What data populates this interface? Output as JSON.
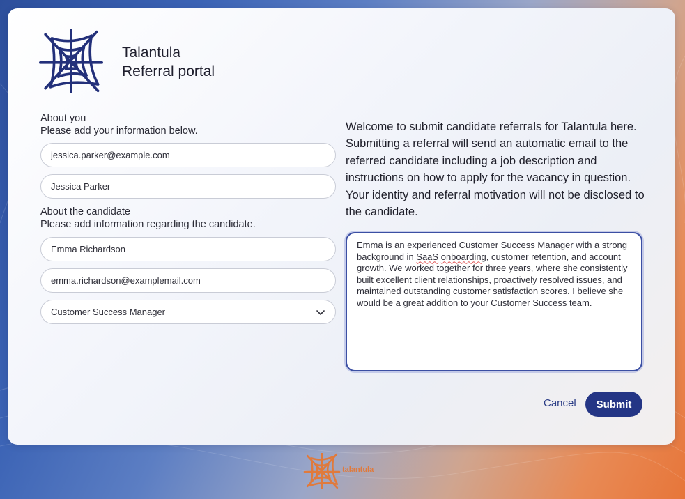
{
  "brand": {
    "line1": "Talantula",
    "line2": "Referral portal",
    "logo_icon": "spider-web-icon",
    "logo_color": "#23307a"
  },
  "about_you": {
    "title": "About you",
    "subtitle": "Please add your information below.",
    "email_value": "jessica.parker@example.com",
    "name_value": "Jessica Parker"
  },
  "about_candidate": {
    "title": "About the candidate",
    "subtitle": "Please add information regarding the candidate.",
    "name_value": "Emma Richardson",
    "email_value": "emma.richardson@examplemail.com",
    "position_selected": "Customer Success Manager"
  },
  "welcome_text": "Welcome to submit candidate referrals for Talantula here. Submitting a referral will send an automatic email to the referred candidate including a job description and instructions on how to apply for the vacancy in question. Your identity and referral motivation will not be disclosed to the candidate.",
  "motivation": {
    "part1": "Emma is an experienced Customer Success Manager with a strong background in ",
    "spell1": "SaaS",
    "space": " ",
    "spell2": "onboarding",
    "part2": ", customer retention, and account growth. We worked together for three years, where she consistently built excellent client relationships, proactively resolved issues, and maintained outstanding customer satisfaction scores. I believe she would be a great addition to your Customer Success team."
  },
  "actions": {
    "cancel_label": "Cancel",
    "submit_label": "Submit"
  },
  "footer": {
    "brand_text": "talantula",
    "logo_icon": "spider-web-icon",
    "logo_color": "#e07a3c"
  },
  "colors": {
    "primary": "#243585",
    "accent": "#e07a3c"
  }
}
